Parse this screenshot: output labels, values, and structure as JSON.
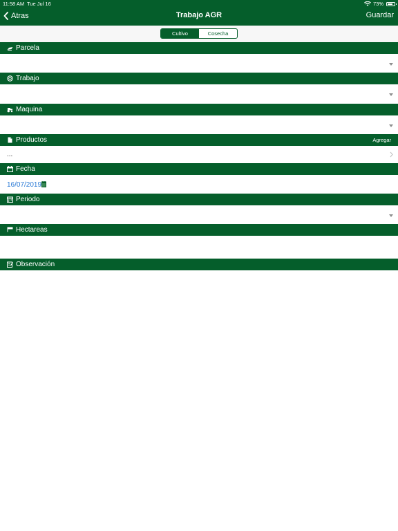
{
  "status": {
    "time": "11:58 AM",
    "date": "Tue Jul 16",
    "battery": "73%",
    "battery_level": 0.73
  },
  "nav": {
    "back_label": "Atras",
    "title": "Trabajo AGR",
    "save_label": "Guardar"
  },
  "segments": {
    "selected": "Cultivo",
    "items": [
      "Cultivo",
      "Cosecha"
    ]
  },
  "sections": {
    "parcela": {
      "label": "Parcela",
      "icon": "tractor-plow-icon",
      "value": ""
    },
    "trabajo": {
      "label": "Trabajo",
      "icon": "target-icon",
      "value": ""
    },
    "maquina": {
      "label": "Maquina",
      "icon": "tractor-icon",
      "value": ""
    },
    "productos": {
      "label": "Productos",
      "icon": "document-icon",
      "action": "Agregar",
      "value": "..."
    },
    "fecha": {
      "label": "Fecha",
      "icon": "calendar-icon",
      "value": "16/07/2019"
    },
    "periodo": {
      "label": "Periodo",
      "icon": "calendar-grid-icon",
      "value": ""
    },
    "hectareas": {
      "label": "Hectareas",
      "icon": "flag-icon",
      "value": ""
    },
    "observacion": {
      "label": "Observación",
      "icon": "edit-note-icon"
    }
  },
  "colors": {
    "primary": "#055e2b",
    "link": "#2c7bd6"
  }
}
